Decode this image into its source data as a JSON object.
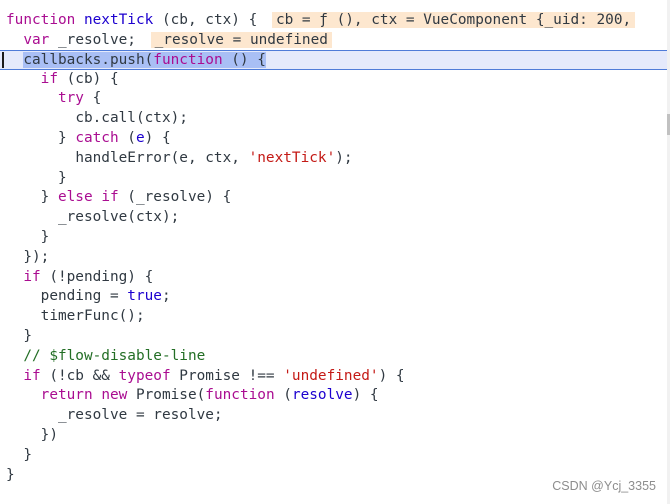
{
  "code": {
    "l1": {
      "kw": "function",
      "name": "nextTick",
      "rest": " (cb, ctx) {",
      "inline": "cb = ƒ (), ctx = VueComponent {_uid: 200,"
    },
    "l2": {
      "indent": "  ",
      "kw": "var",
      "rest": " _resolve;",
      "inline": "_resolve = undefined"
    },
    "l3": {
      "indent": "  ",
      "pre": "callbacks.push(",
      "kw": "function",
      "post": " () {",
      "tail": ""
    },
    "l4": {
      "indent": "    ",
      "kw": "if",
      "rest": " (cb) {"
    },
    "l5": {
      "indent": "      ",
      "kw": "try",
      "rest": " {"
    },
    "l6": {
      "indent": "        ",
      "text": "cb.call(ctx);"
    },
    "l7": {
      "indent": "      ",
      "pre": "} ",
      "kw": "catch",
      "p1": " (",
      "param": "e",
      "p2": ") {"
    },
    "l8": {
      "indent": "        ",
      "pre": "handleError(e, ctx, ",
      "str": "'nextTick'",
      "post": ");"
    },
    "l9": {
      "indent": "      ",
      "text": "}"
    },
    "l10": {
      "indent": "    ",
      "pre": "} ",
      "kw1": "else",
      "sp": " ",
      "kw2": "if",
      "rest": " (_resolve) {"
    },
    "l11": {
      "indent": "      ",
      "text": "_resolve(ctx);"
    },
    "l12": {
      "indent": "    ",
      "text": "}"
    },
    "l13": {
      "indent": "  ",
      "text": "});"
    },
    "l14": {
      "indent": "  ",
      "kw": "if",
      "rest": " (!pending) {"
    },
    "l15": {
      "indent": "    ",
      "pre": "pending = ",
      "val": "true",
      "post": ";"
    },
    "l16": {
      "indent": "    ",
      "text": "timerFunc();"
    },
    "l17": {
      "indent": "  ",
      "text": "}"
    },
    "l18": {
      "indent": "  ",
      "comment": "// $flow-disable-line"
    },
    "l19": {
      "indent": "  ",
      "kw1": "if",
      "p1": " (!cb && ",
      "kw2": "typeof",
      "p2": " Promise !== ",
      "str": "'undefined'",
      "p3": ") {"
    },
    "l20": {
      "indent": "    ",
      "kw1": "return",
      "sp": " ",
      "kw2": "new",
      "p1": " Promise(",
      "kw3": "function",
      "p2": " (",
      "param": "resolve",
      "p3": ") {"
    },
    "l21": {
      "indent": "      ",
      "text": "_resolve = resolve;"
    },
    "l22": {
      "indent": "    ",
      "text": "})"
    },
    "l23": {
      "indent": "  ",
      "text": "}"
    },
    "l24": {
      "indent": "",
      "text": "}"
    }
  },
  "watermark": "CSDN @Ycj_3355"
}
